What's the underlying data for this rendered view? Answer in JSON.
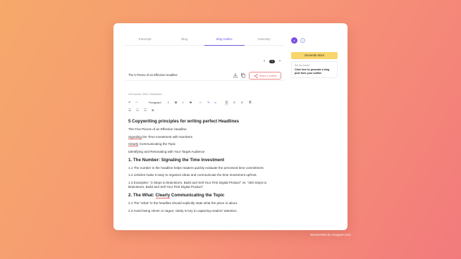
{
  "tabs": [
    "Transcript",
    "Blog",
    "Blog Outline",
    "Summary"
  ],
  "active_tab": "Blog Outline",
  "pager": {
    "prev": "‹",
    "page": "1",
    "next": "›"
  },
  "document": {
    "headline": "The 5 Pieces of an Effective Headline",
    "share_label": "Share Content",
    "stats": "410 words, 2642 Characters",
    "paragraph_style": "Paragraph"
  },
  "content": {
    "title": "5 Copywriting principles for writing perfect Headlines",
    "intro": [
      "The Five Pieces of an Effective Headline",
      "Signaling the Time Investment with Numbers",
      "Clearly Communicating the Topic",
      "Identifying and Resonating with Your Target Audience"
    ],
    "sections": [
      {
        "heading": "1. The Number: Signaling the Time Investment",
        "points": [
          "1.1 The number in the headline helps readers quickly evaluate the perceived time commitment.",
          "1.2 Listicles make it easy to organize ideas and communicate the time investment upfront.",
          "1.3 Examples: \"3 Steps to Brainstorm, Build and Sell Your First Digital Product\" vs. \"300 Steps to Brainstorm, Build and Sell Your First Digital Product\""
        ]
      },
      {
        "heading": "2. The What: Clearly Communicating the Topic",
        "points": [
          "2.1 The \"what\" in the headline should explicitly state what the piece is about.",
          "2.2 Avoid being clever or vague; clarity is key to capturing readers' attention."
        ]
      }
    ]
  },
  "sidebar": {
    "avatar_initial": "#",
    "help_symbol": "?",
    "generate_label": "Generate More",
    "tip_heading": "Did You Know?",
    "tip_body": "Click here to generate a blog post from your outline"
  },
  "watermark": "Screenshot by Xnapper.com",
  "colors": {
    "accent": "#6b5ce7",
    "share": "#e06a6a",
    "generate": "#f8d66d"
  }
}
